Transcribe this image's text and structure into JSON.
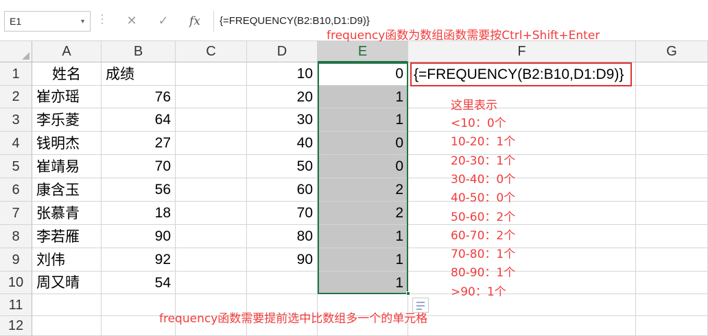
{
  "formula_bar": {
    "name_box": "E1",
    "cancel_symbol": "✕",
    "enter_symbol": "✓",
    "fx_symbol": "fx",
    "formula": "{=FREQUENCY(B2:B10,D1:D9)}"
  },
  "columns": [
    "A",
    "B",
    "C",
    "D",
    "E",
    "F",
    "G"
  ],
  "rows": [
    "1",
    "2",
    "3",
    "4",
    "5",
    "6",
    "7",
    "8",
    "9",
    "10",
    "11",
    "12"
  ],
  "cells": {
    "A": [
      "姓名",
      "崔亦瑶",
      "李乐菱",
      "钱明杰",
      "崔靖易",
      "康含玉",
      "张慕青",
      "李若雁",
      "刘伟",
      "周又晴"
    ],
    "B": [
      "成绩",
      "76",
      "64",
      "27",
      "70",
      "56",
      "18",
      "90",
      "92",
      "54"
    ],
    "D": [
      "10",
      "20",
      "30",
      "40",
      "50",
      "60",
      "70",
      "80",
      "90"
    ],
    "E": [
      "0",
      "1",
      "1",
      "0",
      "0",
      "2",
      "2",
      "1",
      "1",
      "1"
    ]
  },
  "annotations": {
    "top_note": "frequency函数为数组函数需要按Ctrl+Shift+Enter",
    "formula_box": "{=FREQUENCY(B2:B10,D1:D9)}",
    "explain_title": "这里表示",
    "explain_lines": [
      "<10：0个",
      "10-20：1个",
      "20-30：1个",
      "30-40：0个",
      "40-50：0个",
      "50-60：2个",
      "60-70：2个",
      "70-80：1个",
      "80-90：1个",
      ">90：1个"
    ],
    "bottom_note": "frequency函数需要提前选中比数组多一个的单元格"
  },
  "colors": {
    "annotation_red": "#f23b3b",
    "selection_green": "#217346",
    "selection_fill": "#c6c6c6"
  }
}
